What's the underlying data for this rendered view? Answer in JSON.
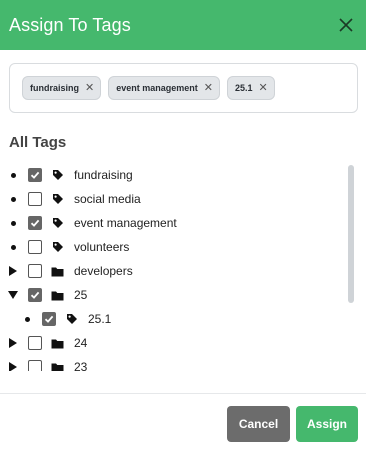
{
  "header": {
    "title": "Assign To Tags",
    "close_icon": "close-icon"
  },
  "selected_tags": [
    {
      "label": "fundraising"
    },
    {
      "label": "event management"
    },
    {
      "label": "25.1"
    }
  ],
  "section_title": "All Tags",
  "tree": [
    {
      "label": "fundraising",
      "type": "tag",
      "marker": "bullet",
      "checked": true,
      "depth": 0
    },
    {
      "label": "social media",
      "type": "tag",
      "marker": "bullet",
      "checked": false,
      "depth": 0
    },
    {
      "label": "event management",
      "type": "tag",
      "marker": "bullet",
      "checked": true,
      "depth": 0
    },
    {
      "label": "volunteers",
      "type": "tag",
      "marker": "bullet",
      "checked": false,
      "depth": 0
    },
    {
      "label": "developers",
      "type": "folder",
      "marker": "collapsed",
      "checked": false,
      "depth": 0
    },
    {
      "label": "25",
      "type": "folder",
      "marker": "expanded",
      "checked": true,
      "depth": 0
    },
    {
      "label": "25.1",
      "type": "tag",
      "marker": "bullet",
      "checked": true,
      "depth": 1
    },
    {
      "label": "24",
      "type": "folder",
      "marker": "collapsed",
      "checked": false,
      "depth": 0
    },
    {
      "label": "23",
      "type": "folder",
      "marker": "collapsed",
      "checked": false,
      "depth": 0
    }
  ],
  "footer": {
    "cancel_label": "Cancel",
    "assign_label": "Assign"
  },
  "colors": {
    "header": "#45b86d",
    "assign": "#45b86d",
    "cancel": "#6c6c6c",
    "checkbox_checked": "#666666"
  }
}
